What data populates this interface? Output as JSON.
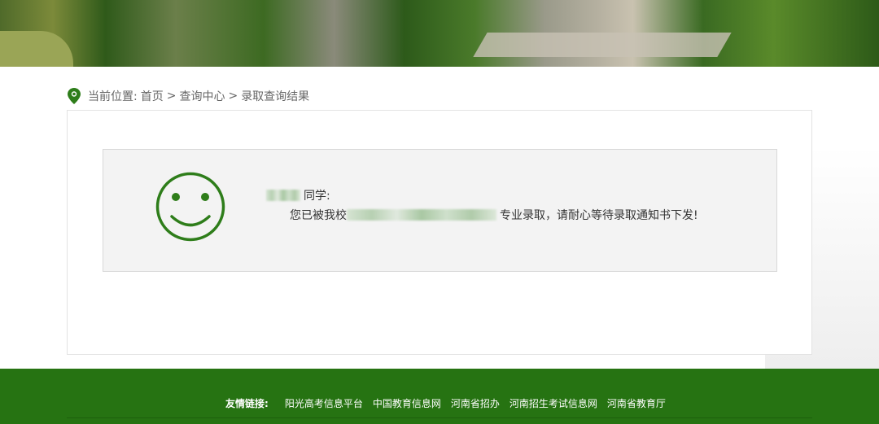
{
  "breadcrumb": {
    "label": "当前位置:",
    "items": [
      "首页",
      "查询中心",
      "录取查询结果"
    ],
    "separator": ">"
  },
  "message": {
    "greeting_suffix": "同学:",
    "prefix": "您已被我校",
    "suffix": "专业录取，请耐心等待录取通知书下发!"
  },
  "footer": {
    "label": "友情链接:",
    "links": [
      "阳光高考信息平台",
      "中国教育信息网",
      "河南省招办",
      "河南招生考试信息网",
      "河南省教育厅"
    ]
  },
  "colors": {
    "brand": "#267312",
    "smile": "#2e7d1a"
  }
}
